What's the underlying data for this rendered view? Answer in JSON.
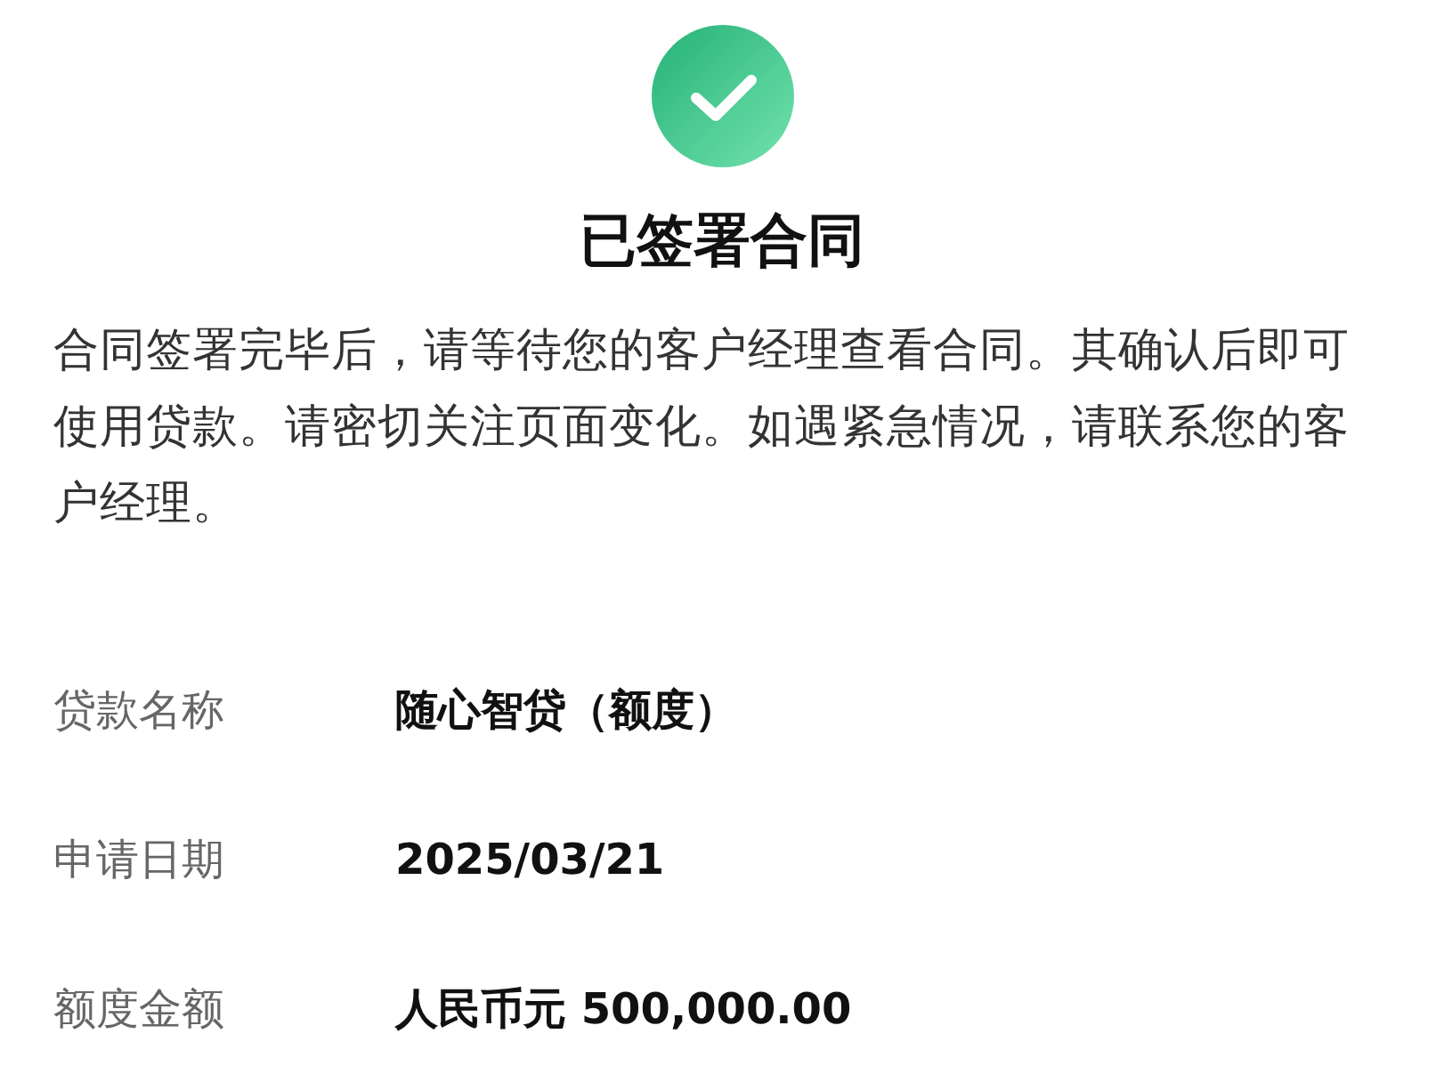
{
  "status": {
    "title": "已签署合同",
    "message": "合同签署完毕后，请等待您的客户经理查看合同。其确认后即可使用贷款。请密切关注页面变化。如遇紧急情况，请联系您的客户经理。"
  },
  "details": [
    {
      "label": "贷款名称",
      "value": "随心智贷（额度）"
    },
    {
      "label": "申请日期",
      "value": "2025/03/21"
    },
    {
      "label": "额度金额",
      "value": "人民币元 500,000.00"
    }
  ]
}
